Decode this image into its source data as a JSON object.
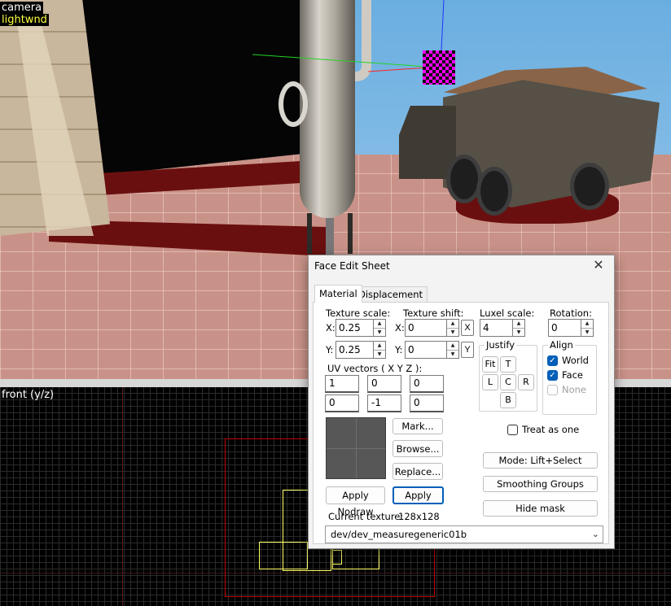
{
  "viewports": {
    "camera": {
      "label": "camera",
      "sublabel": "lightwnd"
    },
    "front": {
      "label": "front (y/z)"
    }
  },
  "dialog": {
    "title": "Face Edit Sheet",
    "close_icon": "close-icon",
    "tabs": [
      {
        "label": "Material",
        "active": true
      },
      {
        "label": "Displacement",
        "active": false
      }
    ],
    "texture_scale": {
      "label": "Texture scale:",
      "x_label": "X:",
      "x": "0.25",
      "y_label": "Y:",
      "y": "0.25"
    },
    "texture_shift": {
      "label": "Texture shift:",
      "x_label": "X:",
      "x": "0",
      "y_label": "Y:",
      "y": "0",
      "x_button": "X",
      "y_button": "Y"
    },
    "luxel_scale": {
      "label": "Luxel scale:",
      "value": "4"
    },
    "rotation": {
      "label": "Rotation:",
      "value": "0"
    },
    "uv_vectors": {
      "label": "UV vectors ( X Y Z ):",
      "rows": [
        [
          "1",
          "0",
          "0"
        ],
        [
          "0",
          "-1",
          "0"
        ]
      ]
    },
    "justify": {
      "title": "Justify",
      "fit": "Fit",
      "top": "T",
      "left": "L",
      "center": "C",
      "right": "R",
      "bottom": "B"
    },
    "align": {
      "title": "Align",
      "world": {
        "label": "World",
        "checked": true
      },
      "face": {
        "label": "Face",
        "checked": true
      },
      "none": {
        "label": "None",
        "checked": false,
        "disabled": true
      }
    },
    "treat_as_one": {
      "label": "Treat as one",
      "checked": false
    },
    "buttons": {
      "mark": "Mark...",
      "browse": "Browse...",
      "replace": "Replace...",
      "apply_nodraw": "Apply Nodraw",
      "apply": "Apply",
      "mode": "Mode: Lift+Select",
      "smoothing_groups": "Smoothing Groups",
      "hide_mask": "Hide mask"
    },
    "current_texture": {
      "label": "Current texture:",
      "size": "128x128"
    },
    "texture_name": "dev/dev_measuregeneric01b",
    "dropdown_icon": "chevron-down-icon"
  },
  "colors": {
    "accent": "#005fb8",
    "viewport_label_highlight": "#ffff3c",
    "selection_red": "#c00000",
    "ortho_yellow": "#ffff66"
  }
}
